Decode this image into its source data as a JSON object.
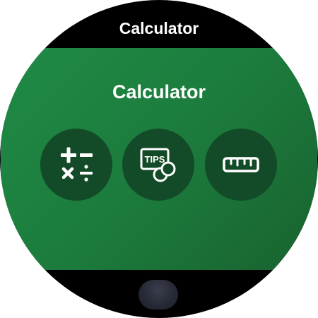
{
  "status_bar": {
    "title": "Calculator"
  },
  "tile": {
    "title": "Calculator",
    "shortcuts": [
      {
        "icon": "arithmetic-operators-icon"
      },
      {
        "icon": "tip-calculator-icon",
        "badge_text": "TIPS"
      },
      {
        "icon": "ruler-icon"
      }
    ]
  },
  "colors": {
    "background": "#000000",
    "tile_gradient_start": "#1f8a45",
    "tile_gradient_end": "#18622f",
    "shortcut_background": "#134a27",
    "text": "#ffffff",
    "home_button": "#2a2c38"
  }
}
